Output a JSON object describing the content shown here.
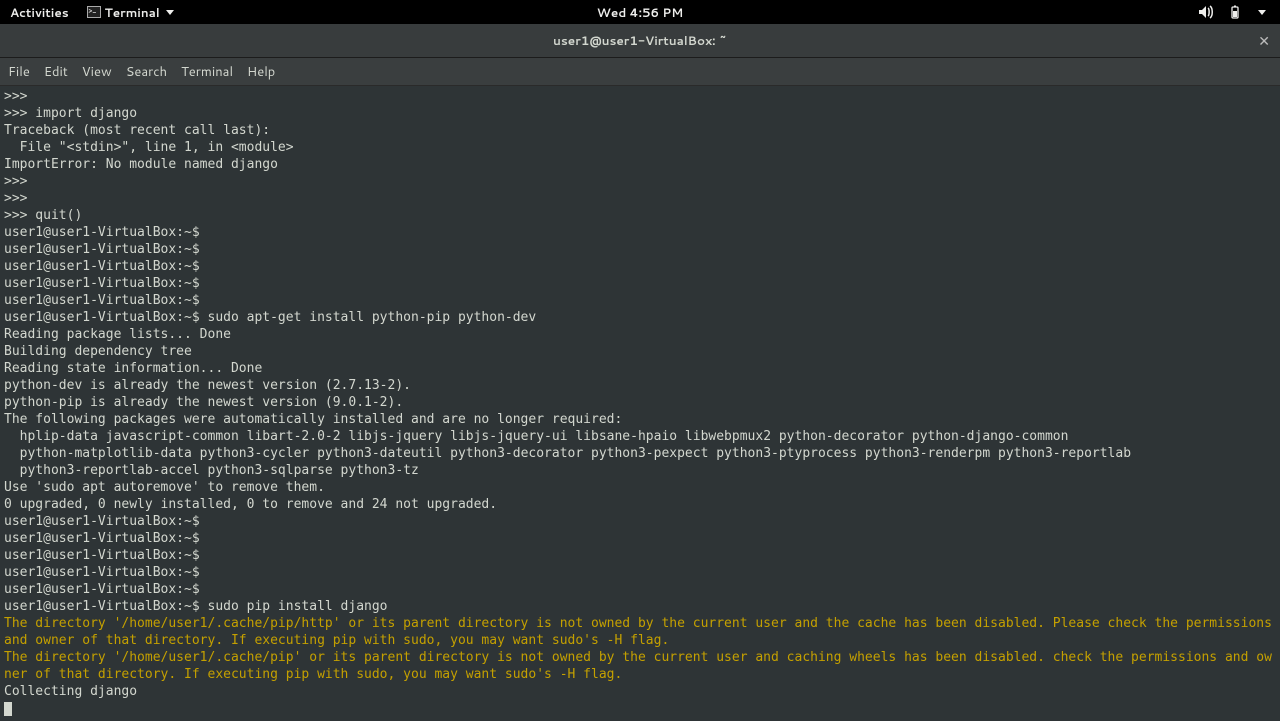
{
  "topbar": {
    "activities": "Activities",
    "app_name": "Terminal",
    "clock": "Wed  4:56 PM"
  },
  "titlebar": {
    "title": "user1@user1-VirtualBox: ~"
  },
  "menubar": {
    "items": [
      "File",
      "Edit",
      "View",
      "Search",
      "Terminal",
      "Help"
    ]
  },
  "terminal": {
    "lines": [
      {
        "text": ">>> ",
        "cls": ""
      },
      {
        "text": ">>> import django",
        "cls": ""
      },
      {
        "text": "Traceback (most recent call last):",
        "cls": ""
      },
      {
        "text": "  File \"<stdin>\", line 1, in <module>",
        "cls": ""
      },
      {
        "text": "ImportError: No module named django",
        "cls": ""
      },
      {
        "text": ">>> ",
        "cls": ""
      },
      {
        "text": ">>> ",
        "cls": ""
      },
      {
        "text": ">>> quit()",
        "cls": ""
      },
      {
        "text": "user1@user1-VirtualBox:~$ ",
        "cls": ""
      },
      {
        "text": "user1@user1-VirtualBox:~$ ",
        "cls": ""
      },
      {
        "text": "user1@user1-VirtualBox:~$ ",
        "cls": ""
      },
      {
        "text": "user1@user1-VirtualBox:~$ ",
        "cls": ""
      },
      {
        "text": "user1@user1-VirtualBox:~$ ",
        "cls": ""
      },
      {
        "text": "user1@user1-VirtualBox:~$ sudo apt-get install python-pip python-dev",
        "cls": ""
      },
      {
        "text": "Reading package lists... Done",
        "cls": ""
      },
      {
        "text": "Building dependency tree       ",
        "cls": ""
      },
      {
        "text": "Reading state information... Done",
        "cls": ""
      },
      {
        "text": "python-dev is already the newest version (2.7.13-2).",
        "cls": ""
      },
      {
        "text": "python-pip is already the newest version (9.0.1-2).",
        "cls": ""
      },
      {
        "text": "The following packages were automatically installed and are no longer required:",
        "cls": ""
      },
      {
        "text": "  hplip-data javascript-common libart-2.0-2 libjs-jquery libjs-jquery-ui libsane-hpaio libwebpmux2 python-decorator python-django-common",
        "cls": ""
      },
      {
        "text": "  python-matplotlib-data python3-cycler python3-dateutil python3-decorator python3-pexpect python3-ptyprocess python3-renderpm python3-reportlab",
        "cls": ""
      },
      {
        "text": "  python3-reportlab-accel python3-sqlparse python3-tz",
        "cls": ""
      },
      {
        "text": "Use 'sudo apt autoremove' to remove them.",
        "cls": ""
      },
      {
        "text": "0 upgraded, 0 newly installed, 0 to remove and 24 not upgraded.",
        "cls": ""
      },
      {
        "text": "user1@user1-VirtualBox:~$ ",
        "cls": ""
      },
      {
        "text": "user1@user1-VirtualBox:~$ ",
        "cls": ""
      },
      {
        "text": "user1@user1-VirtualBox:~$ ",
        "cls": ""
      },
      {
        "text": "user1@user1-VirtualBox:~$ ",
        "cls": ""
      },
      {
        "text": "user1@user1-VirtualBox:~$ ",
        "cls": ""
      },
      {
        "text": "user1@user1-VirtualBox:~$ sudo pip install django",
        "cls": ""
      },
      {
        "text": "The directory '/home/user1/.cache/pip/http' or its parent directory is not owned by the current user and the cache has been disabled. Please check the permissions and owner of that directory. If executing pip with sudo, you may want sudo's -H flag.",
        "cls": "yellow"
      },
      {
        "text": "The directory '/home/user1/.cache/pip' or its parent directory is not owned by the current user and caching wheels has been disabled. check the permissions and owner of that directory. If executing pip with sudo, you may want sudo's -H flag.",
        "cls": "yellow"
      },
      {
        "text": "Collecting django",
        "cls": ""
      }
    ]
  }
}
